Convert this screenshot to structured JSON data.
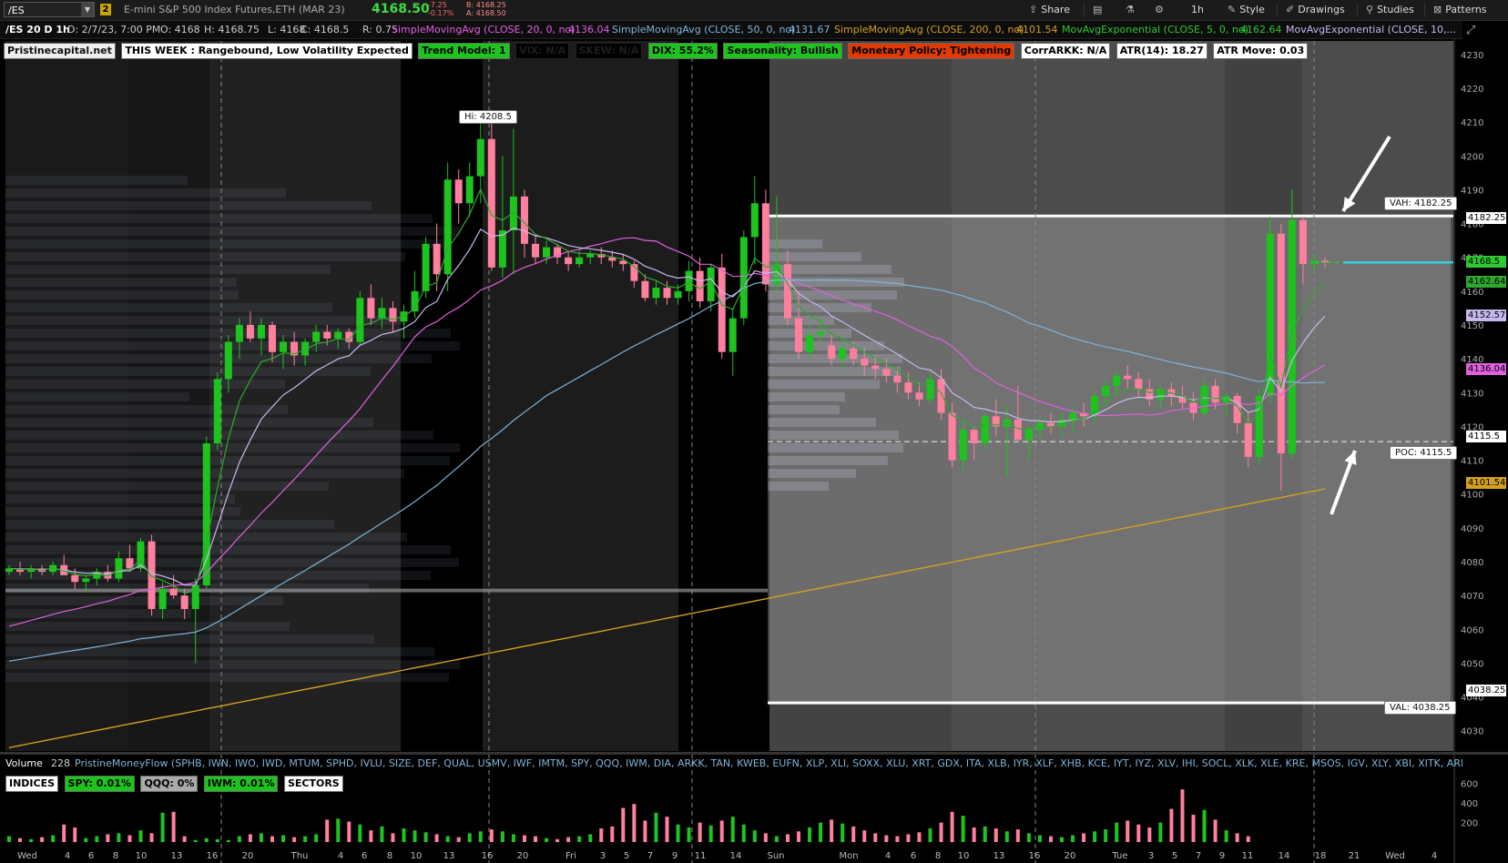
{
  "toolbar": {
    "symbol": "/ES",
    "link_badge": "2",
    "description": "E-mini S&P 500 Index Futures,ETH (MAR 23)",
    "last": "4168.50",
    "net_change": "-7.25",
    "pct_change": "-0.17%",
    "bid": "B: 4168.25",
    "ask": "A: 4168.50",
    "share": "Share",
    "timeframe": "1h",
    "style": "Style",
    "drawings": "Drawings",
    "studies": "Studies",
    "patterns": "Patterns"
  },
  "status": {
    "chart_id": "/ES 20 D 1h",
    "date": "D: 2/7/23, 7:00 PM",
    "open": "O: 4168",
    "high": "H: 4168.75",
    "low": "L: 4168",
    "close": "C: 4168.5",
    "range": "R: 0.75",
    "sma20": "SimpleMovingAvg (CLOSE, 20, 0, no)",
    "sma20_val": "4136.04",
    "sma50": "SimpleMovingAvg (CLOSE, 50, 0, no)",
    "sma50_val": "4131.67",
    "sma200": "SimpleMovingAvg (CLOSE, 200, 0, no)",
    "sma200_val": "4101.54",
    "ema5": "MovAvgExponential (CLOSE, 5, 0, no)",
    "ema5_val": "4162.64",
    "ema10": "MovAvgExponential (CLOSE, 10,..."
  },
  "labels": {
    "site": "Pristinecapital.net",
    "week": "THIS WEEK : Rangebound, Low Volatility Expected",
    "trend": "Trend Model: 1",
    "hidden1": "VIX: N/A",
    "hidden2": "SKEW: N/A",
    "dix": "DIX: 55.2%",
    "seasonality": "Seasonality: Bullish",
    "monetary": "Monetary Policy: Tightening",
    "corr": "CorrARKK: N/A",
    "atr": "ATR(14): 18.27",
    "atr_move": "ATR Move: 0.03"
  },
  "callouts": {
    "hi": "Hi: 4208.5",
    "vah": "VAH: 4182.25",
    "poc": "POC: 4115.5",
    "val": "VAL: 4038.25"
  },
  "price_badges": {
    "vah": "4182.25",
    "last": "4168.5",
    "ema5": "4162.64",
    "ema10": "4152.57",
    "sma20": "4136.04",
    "poc": "4115.5",
    "sma200": "4101.54",
    "val": "4038.25"
  },
  "volume": {
    "label": "Volume",
    "value": "228",
    "flow": "PristineMoneyFlow (SPHB, IWN, IWO, IWD, MTUM, SPHD, IVLU, SIZE, DEF, QUAL, USMV, IWF, IMTM, SPY, QQQ, IWM, DIA, ARKK, TAN, KWEB, EUFN, XLP, XLI, SOXX, XLU, XRT, GDX, ITA, XLB, IYR, XLF, XHB, KCE, IYT, IYZ, XLV, IHI, SOCL, XLK, XLE, KRE, MSOS, IGV, XLY, XBI, XITK, ARKG, ARKF, BLOK)",
    "indices": "INDICES",
    "spy": "SPY: 0.01%",
    "qqq": "QQQ: 0%",
    "iwm": "IWM: 0.01%",
    "sectors": "SECTORS"
  },
  "colors": {
    "up": "#1ec41e",
    "down": "#ff7f9e",
    "sma20": "#e060e0",
    "sma50": "#7fb4d8",
    "sma200": "#d4a020",
    "ema5": "#2fa82f",
    "ema10": "#c8b8f0",
    "last_line": "#30d0e0"
  },
  "chart_data": {
    "type": "candlestick",
    "title": "/ES 20 D 1h",
    "y_axis_ticks": [
      4230,
      4220,
      4210,
      4200,
      4190,
      4180,
      4170,
      4160,
      4150,
      4140,
      4130,
      4120,
      4110,
      4100,
      4090,
      4080,
      4070,
      4060,
      4050,
      4040,
      4030
    ],
    "ylim": [
      4024,
      4234
    ],
    "x_axis_labels": [
      "Wed",
      "4",
      "6",
      "8",
      "10",
      "13",
      "16",
      "20",
      "Thu",
      "4",
      "6",
      "8",
      "10",
      "13",
      "16",
      "20",
      "Fri",
      "3",
      "5",
      "7",
      "9",
      "11",
      "14",
      "Sun",
      "Mon",
      "4",
      "6",
      "8",
      "10",
      "13",
      "16",
      "20",
      "Tue",
      "3",
      "5",
      "7",
      "9",
      "11",
      "14",
      "18",
      "21",
      "Wed",
      "4"
    ],
    "volume_axis_ticks": [
      600,
      400,
      200
    ],
    "levels": {
      "hi": 4208.5,
      "vah": 4182.25,
      "poc": 4115.5,
      "val": 4038.25,
      "last": 4168.5
    },
    "candles": [
      [
        4077,
        4079,
        4076,
        4078
      ],
      [
        4078,
        4080,
        4076,
        4077
      ],
      [
        4077,
        4079,
        4075,
        4078
      ],
      [
        4078,
        4079,
        4076,
        4077
      ],
      [
        4077,
        4080,
        4076,
        4079
      ],
      [
        4079,
        4082,
        4077,
        4076
      ],
      [
        4076,
        4078,
        4072,
        4074
      ],
      [
        4074,
        4076,
        4071,
        4075
      ],
      [
        4075,
        4078,
        4073,
        4077
      ],
      [
        4077,
        4079,
        4074,
        4075
      ],
      [
        4075,
        4083,
        4074,
        4081
      ],
      [
        4081,
        4085,
        4077,
        4078
      ],
      [
        4078,
        4087,
        4077,
        4086
      ],
      [
        4086,
        4088,
        4064,
        4066
      ],
      [
        4066,
        4074,
        4063,
        4072
      ],
      [
        4072,
        4076,
        4069,
        4070
      ],
      [
        4070,
        4072,
        4063,
        4066
      ],
      [
        4066,
        4075,
        4050,
        4073
      ],
      [
        4073,
        4117,
        4072,
        4115
      ],
      [
        4115,
        4136,
        4113,
        4134
      ],
      [
        4134,
        4147,
        4130,
        4145
      ],
      [
        4145,
        4152,
        4140,
        4150
      ],
      [
        4150,
        4154,
        4145,
        4146
      ],
      [
        4146,
        4152,
        4141,
        4150
      ],
      [
        4150,
        4151,
        4139,
        4142
      ],
      [
        4142,
        4147,
        4137,
        4145
      ],
      [
        4145,
        4148,
        4138,
        4141
      ],
      [
        4141,
        4146,
        4138,
        4145
      ],
      [
        4145,
        4150,
        4142,
        4148
      ],
      [
        4148,
        4150,
        4144,
        4146
      ],
      [
        4146,
        4149,
        4143,
        4148
      ],
      [
        4148,
        4149,
        4143,
        4145
      ],
      [
        4145,
        4160,
        4144,
        4158
      ],
      [
        4158,
        4162,
        4150,
        4152
      ],
      [
        4152,
        4158,
        4149,
        4155
      ],
      [
        4155,
        4157,
        4148,
        4151
      ],
      [
        4151,
        4156,
        4146,
        4154
      ],
      [
        4154,
        4166,
        4152,
        4160
      ],
      [
        4160,
        4176,
        4158,
        4174
      ],
      [
        4174,
        4180,
        4160,
        4165
      ],
      [
        4165,
        4198,
        4160,
        4193
      ],
      [
        4193,
        4196,
        4180,
        4186
      ],
      [
        4186,
        4198,
        4182,
        4194
      ],
      [
        4194,
        4210,
        4186,
        4205
      ],
      [
        4205,
        4210,
        4166,
        4167
      ],
      [
        4167,
        4200,
        4164,
        4178
      ],
      [
        4178,
        4208,
        4165,
        4188
      ],
      [
        4188,
        4190,
        4170,
        4174
      ],
      [
        4174,
        4177,
        4168,
        4170
      ],
      [
        4170,
        4175,
        4168,
        4173
      ],
      [
        4173,
        4174,
        4168,
        4170
      ],
      [
        4170,
        4172,
        4166,
        4168
      ],
      [
        4168,
        4172,
        4167,
        4170
      ],
      [
        4170,
        4172,
        4168,
        4171
      ],
      [
        4171,
        4173,
        4168,
        4170
      ],
      [
        4170,
        4172,
        4167,
        4169
      ],
      [
        4169,
        4171,
        4166,
        4168
      ],
      [
        4168,
        4169,
        4161,
        4163
      ],
      [
        4163,
        4165,
        4157,
        4158
      ],
      [
        4158,
        4163,
        4156,
        4161
      ],
      [
        4161,
        4163,
        4156,
        4158
      ],
      [
        4158,
        4162,
        4156,
        4160
      ],
      [
        4160,
        4169,
        4157,
        4166
      ],
      [
        4166,
        4170,
        4155,
        4157
      ],
      [
        4157,
        4168,
        4154,
        4167
      ],
      [
        4167,
        4171,
        4140,
        4142
      ],
      [
        4142,
        4155,
        4135,
        4152
      ],
      [
        4152,
        4178,
        4150,
        4176
      ],
      [
        4176,
        4194,
        4168,
        4186
      ],
      [
        4186,
        4190,
        4160,
        4162
      ],
      [
        4162,
        4188,
        4160,
        4168
      ],
      [
        4168,
        4172,
        4150,
        4152
      ],
      [
        4152,
        4160,
        4140,
        4142
      ],
      [
        4142,
        4150,
        4140,
        4147
      ],
      [
        4147,
        4152,
        4145,
        4148
      ],
      [
        4144,
        4147,
        4138,
        4140
      ],
      [
        4140,
        4145,
        4137,
        4143
      ],
      [
        4143,
        4145,
        4138,
        4140
      ],
      [
        4140,
        4143,
        4135,
        4138
      ],
      [
        4138,
        4141,
        4134,
        4137
      ],
      [
        4137,
        4140,
        4133,
        4135
      ],
      [
        4135,
        4137,
        4130,
        4133
      ],
      [
        4133,
        4136,
        4128,
        4130
      ],
      [
        4130,
        4133,
        4126,
        4128
      ],
      [
        4128,
        4136,
        4127,
        4134
      ],
      [
        4134,
        4137,
        4122,
        4124
      ],
      [
        4124,
        4127,
        4108,
        4110
      ],
      [
        4110,
        4122,
        4107,
        4119
      ],
      [
        4119,
        4120,
        4110,
        4115
      ],
      [
        4115,
        4124,
        4113,
        4123
      ],
      [
        4123,
        4128,
        4117,
        4120
      ],
      [
        4120,
        4126,
        4105,
        4122
      ],
      [
        4122,
        4132,
        4118,
        4116
      ],
      [
        4116,
        4120,
        4110,
        4119
      ],
      [
        4119,
        4123,
        4116,
        4121
      ],
      [
        4121,
        4124,
        4118,
        4120
      ],
      [
        4120,
        4124,
        4117,
        4122
      ],
      [
        4122,
        4126,
        4118,
        4124
      ],
      [
        4124,
        4127,
        4120,
        4123
      ],
      [
        4123,
        4130,
        4121,
        4129
      ],
      [
        4129,
        4134,
        4126,
        4132
      ],
      [
        4132,
        4137,
        4129,
        4135
      ],
      [
        4135,
        4138,
        4131,
        4134
      ],
      [
        4134,
        4136,
        4129,
        4131
      ],
      [
        4131,
        4134,
        4126,
        4128
      ],
      [
        4128,
        4132,
        4125,
        4131
      ],
      [
        4131,
        4133,
        4126,
        4129
      ],
      [
        4129,
        4132,
        4125,
        4127
      ],
      [
        4127,
        4130,
        4122,
        4124
      ],
      [
        4124,
        4134,
        4123,
        4132
      ],
      [
        4132,
        4134,
        4125,
        4127
      ],
      [
        4127,
        4130,
        4123,
        4129
      ],
      [
        4129,
        4130,
        4118,
        4121
      ],
      [
        4121,
        4124,
        4108,
        4111
      ],
      [
        4111,
        4131,
        4109,
        4129
      ],
      [
        4129,
        4182,
        4127,
        4177
      ],
      [
        4177,
        4180,
        4101,
        4112
      ],
      [
        4112,
        4190,
        4110,
        4181
      ],
      [
        4181,
        4182,
        4162,
        4168
      ],
      [
        4168,
        4171,
        4166,
        4169
      ],
      [
        4169,
        4170,
        4167,
        4168.5
      ]
    ],
    "volume": [
      60,
      40,
      30,
      50,
      70,
      180,
      150,
      40,
      60,
      80,
      90,
      70,
      120,
      90,
      300,
      310,
      60,
      20,
      40,
      30,
      20,
      60,
      80,
      90,
      60,
      70,
      50,
      60,
      80,
      230,
      240,
      210,
      180,
      120,
      160,
      90,
      140,
      120,
      100,
      80,
      60,
      50,
      90,
      110,
      130,
      110,
      80,
      70,
      60,
      40,
      30,
      50,
      60,
      80,
      140,
      160,
      350,
      390,
      220,
      300,
      260,
      180,
      150,
      200,
      170,
      220,
      260,
      180,
      120,
      90,
      60,
      80,
      110,
      150,
      200,
      230,
      190,
      160,
      120,
      90,
      70,
      60,
      80,
      100,
      140,
      200,
      310,
      270,
      150,
      160,
      140,
      110,
      130,
      90,
      70,
      60,
      50,
      70,
      90,
      110,
      130,
      200,
      220,
      180,
      150,
      200,
      340,
      540,
      280,
      330,
      230,
      120,
      90,
      60
    ]
  }
}
